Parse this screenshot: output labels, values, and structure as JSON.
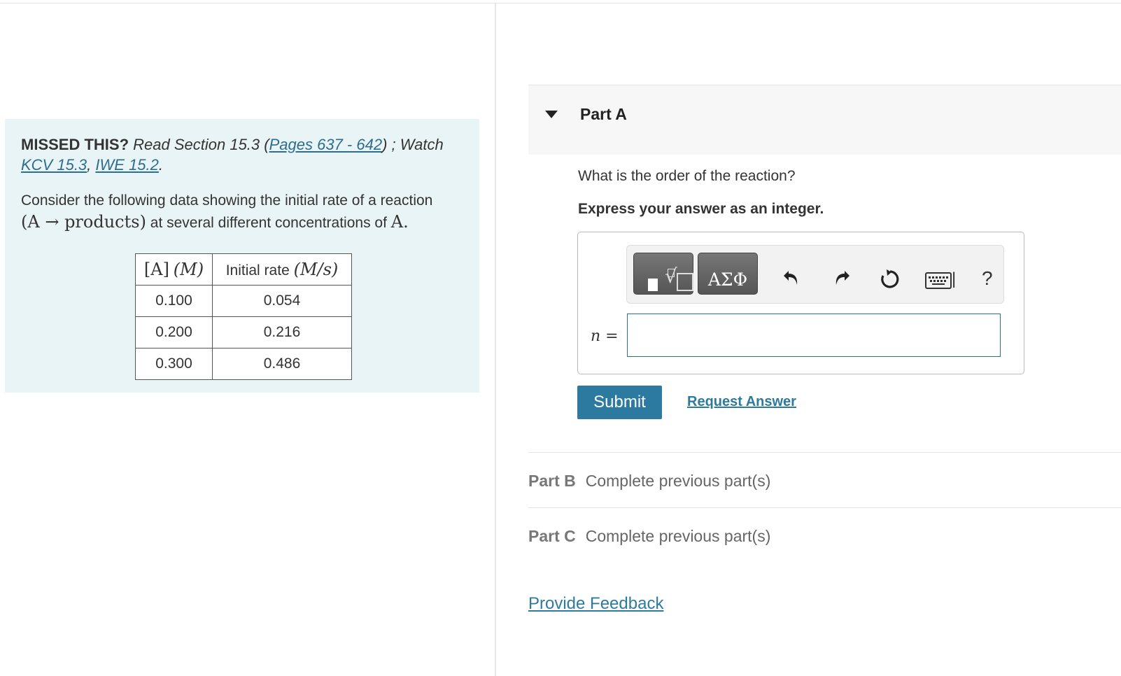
{
  "left": {
    "missed_label": "MISSED THIS?",
    "missed_text1": "Read Section 15.3 (",
    "pages_link": "Pages 637 - 642",
    "missed_text2": ") ; Watch",
    "kcv_link": "KCV 15.3",
    "comma": ", ",
    "iwe_link": "IWE 15.2",
    "period": ".",
    "consider_1": "Consider the following data showing the initial rate of a reaction ",
    "reaction_math": "(A → products)",
    "consider_2": " at several different concentrations of ",
    "species_math": "A.",
    "table": {
      "header_conc": "[A] (M)",
      "header_conc_math_a": "[A]",
      "header_conc_math_b": "(M)",
      "header_rate_text": "Initial rate ",
      "header_rate_math": "(M/s)",
      "rows": [
        {
          "conc": "0.100",
          "rate": "0.054"
        },
        {
          "conc": "0.200",
          "rate": "0.216"
        },
        {
          "conc": "0.300",
          "rate": "0.486"
        }
      ]
    }
  },
  "part_a": {
    "title": "Part A",
    "question": "What is the order of the reaction?",
    "instruction": "Express your answer as an integer.",
    "symbols_label": "ΑΣΦ",
    "answer_label_var": "n",
    "answer_label_eq": " =",
    "answer_value": "",
    "submit_label": "Submit",
    "request_label": "Request Answer"
  },
  "parts": [
    {
      "label": "Part B",
      "status": "Complete previous part(s)"
    },
    {
      "label": "Part C",
      "status": "Complete previous part(s)"
    }
  ],
  "feedback_label": "Provide Feedback",
  "toolbar_icons": [
    "templates-icon",
    "symbols-icon",
    "undo-icon",
    "redo-icon",
    "reset-icon",
    "keyboard-icon",
    "help-icon"
  ],
  "colors": {
    "accent": "#2d7aa0",
    "panel_bg": "#e9f4f6"
  }
}
